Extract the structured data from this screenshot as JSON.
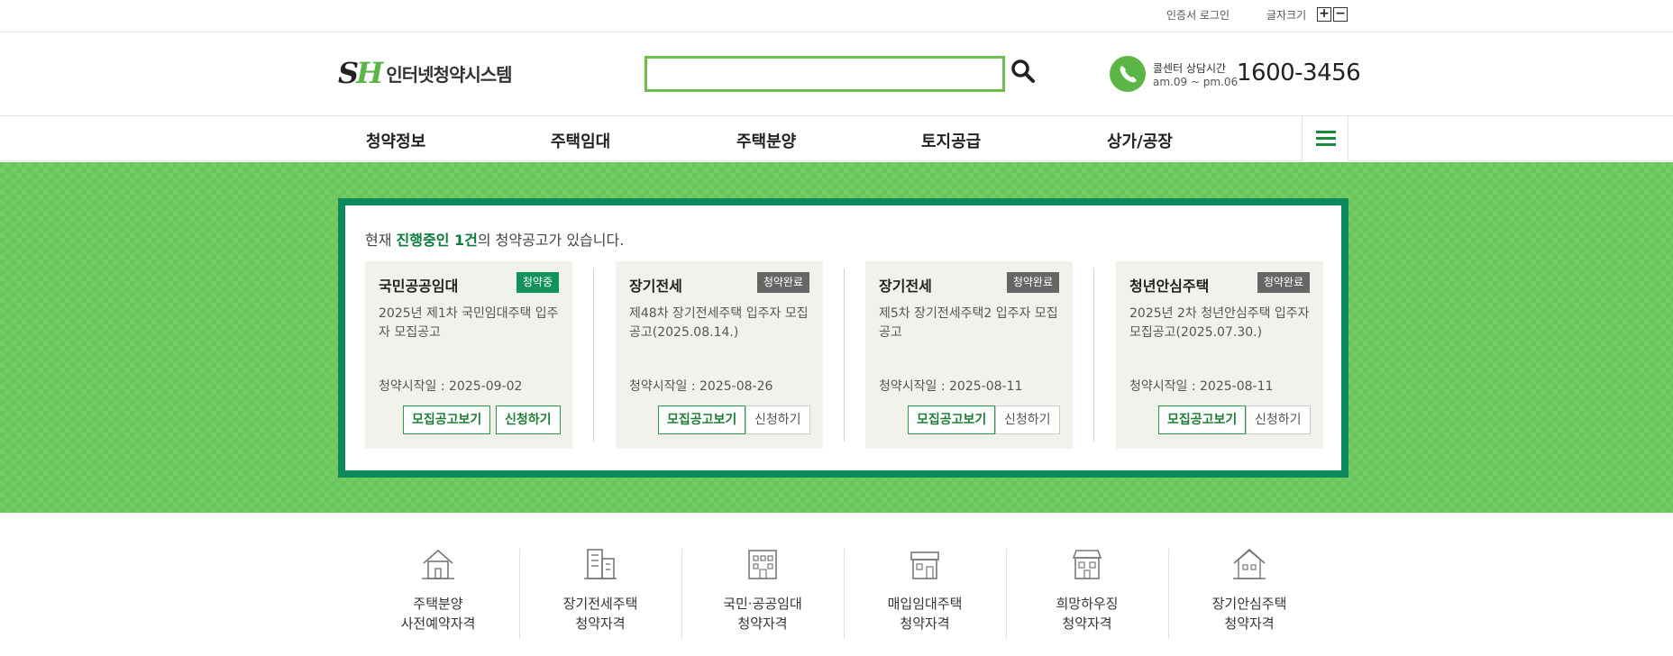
{
  "topbar": {
    "cert_login": "인증서 로그인",
    "font_size_label": "글자크기",
    "font_plus": "+",
    "font_minus": "−"
  },
  "header": {
    "logo_mark_s": "S",
    "logo_mark_h": "H",
    "logo_text": "인터넷청약시스템",
    "search": {
      "value": "",
      "placeholder": ""
    },
    "callcenter_title": "콜센터 상담시간",
    "callcenter_hours": "am.09 ~ pm.06",
    "callcenter_phone": "1600-3456"
  },
  "nav": {
    "items": [
      "청약정보",
      "주택임대",
      "주택분양",
      "토지공급",
      "상가/공장"
    ]
  },
  "notice": {
    "prefix": "현재 ",
    "highlight": "진행중인 1건",
    "suffix": "의 청약공고가 있습니다.",
    "cards": [
      {
        "category": "국민공공임대",
        "status": "청약중",
        "title": "2025년 제1차 국민임대주택 입주자 모집공고",
        "start_date": "청약시작일 : 2025-09-02",
        "view_label": "모집공고보기",
        "apply_label": "신청하기"
      },
      {
        "category": "장기전세",
        "status": "청약완료",
        "title": "제48차 장기전세주택 입주자 모집공고(2025.08.14.)",
        "start_date": "청약시작일 : 2025-08-26",
        "view_label": "모집공고보기",
        "apply_label": "신청하기"
      },
      {
        "category": "장기전세",
        "status": "청약완료",
        "title": "제5차 장기전세주택2 입주자 모집 공고",
        "start_date": "청약시작일 : 2025-08-11",
        "view_label": "모집공고보기",
        "apply_label": "신청하기"
      },
      {
        "category": "청년안심주택",
        "status": "청약완료",
        "title": "2025년 2차 청년안심주택 입주자 모집공고(2025.07.30.)",
        "start_date": "청약시작일 : 2025-08-11",
        "view_label": "모집공고보기",
        "apply_label": "신청하기"
      }
    ]
  },
  "qualifications": [
    {
      "icon": "house-icon",
      "line1": "주택분양",
      "line2": "사전예약자격"
    },
    {
      "icon": "apartment-buildings-icon",
      "line1": "장기전세주택",
      "line2": "청약자격"
    },
    {
      "icon": "office-building-icon",
      "line1": "국민·공공임대",
      "line2": "청약자격"
    },
    {
      "icon": "townhouse-icon",
      "line1": "매입임대주택",
      "line2": "청약자격"
    },
    {
      "icon": "shop-building-icon",
      "line1": "희망하우징",
      "line2": "청약자격"
    },
    {
      "icon": "home-icon",
      "line1": "장기안심주택",
      "line2": "청약자격"
    }
  ],
  "colors": {
    "brand_green": "#5cb646",
    "notice_border": "#0c8a5b",
    "status_active": "#11945a",
    "status_closed": "#666666"
  }
}
